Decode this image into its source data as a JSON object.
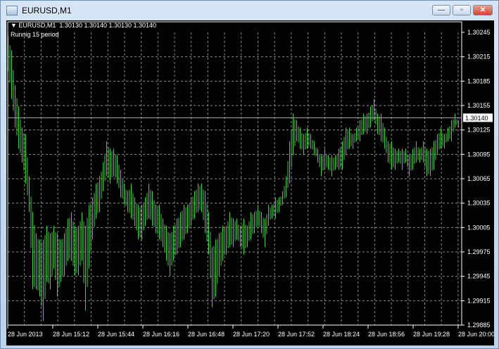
{
  "window": {
    "title": "EURUSD,M1",
    "minimize": "—",
    "maximize": "▫",
    "close": "✕"
  },
  "chart": {
    "header": "▼ EURUSD,M1  1.30130 1.30140 1.30130 1.30140",
    "indicator_label": "Runnig 15  period",
    "current_price": "1.30140",
    "colors": {
      "background": "#000000",
      "bars": "#3fcf3f",
      "grid": "#8a8a8a",
      "text": "#ffffff"
    }
  },
  "chart_data": {
    "type": "bar",
    "title": "EURUSD,M1",
    "ylim": [
      1.29885,
      1.30245
    ],
    "price_ticks": [
      "1.30245",
      "1.30215",
      "1.30185",
      "1.30155",
      "1.30125",
      "1.30095",
      "1.30065",
      "1.30035",
      "1.30005",
      "1.29975",
      "1.29945",
      "1.29915",
      "1.29885"
    ],
    "time_ticks": [
      "28 Jun 2013",
      "28 Jun 15:12",
      "28 Jun 15:44",
      "28 Jun 16:16",
      "28 Jun 16:48",
      "28 Jun 17:20",
      "28 Jun 17:52",
      "28 Jun 18:24",
      "28 Jun 18:56",
      "28 Jun 19:28",
      "28 Jun 20:00"
    ],
    "base_price": 1.29885,
    "point": 1e-05,
    "high_points": [
      356,
      338,
      295,
      269,
      243,
      235,
      183,
      139,
      113,
      105,
      105,
      122,
      113,
      122,
      113,
      105,
      113,
      131,
      139,
      122,
      122,
      139,
      122,
      148,
      157,
      174,
      183,
      200,
      226,
      217,
      217,
      209,
      191,
      174,
      165,
      174,
      157,
      148,
      148,
      157,
      174,
      165,
      148,
      148,
      131,
      122,
      113,
      122,
      131,
      139,
      148,
      148,
      157,
      165,
      174,
      174,
      165,
      139,
      96,
      105,
      113,
      122,
      122,
      139,
      131,
      131,
      122,
      131,
      122,
      139,
      139,
      148,
      139,
      131,
      148,
      148,
      157,
      157,
      165,
      183,
      226,
      260,
      252,
      243,
      235,
      243,
      235,
      226,
      217,
      209,
      217,
      209,
      209,
      209,
      217,
      226,
      243,
      243,
      235,
      243,
      252,
      260,
      260,
      269,
      278,
      260,
      260,
      243,
      226,
      226,
      217,
      217,
      217,
      217,
      209,
      217,
      226,
      217,
      226,
      217,
      217,
      226,
      235,
      243,
      235,
      243,
      252,
      260,
      252
    ],
    "low_points": [
      312,
      278,
      243,
      217,
      200,
      174,
      139,
      44,
      44,
      35,
      5,
      53,
      44,
      70,
      35,
      53,
      61,
      79,
      79,
      61,
      61,
      79,
      18,
      70,
      105,
      131,
      139,
      165,
      183,
      174,
      183,
      174,
      157,
      148,
      139,
      131,
      122,
      105,
      105,
      122,
      131,
      122,
      113,
      105,
      96,
      79,
      61,
      79,
      87,
      96,
      105,
      113,
      122,
      131,
      139,
      139,
      113,
      87,
      22,
      35,
      61,
      79,
      87,
      96,
      96,
      105,
      96,
      87,
      96,
      105,
      113,
      122,
      113,
      96,
      122,
      131,
      131,
      139,
      148,
      157,
      174,
      209,
      226,
      217,
      209,
      217,
      217,
      209,
      200,
      183,
      191,
      191,
      183,
      191,
      191,
      191,
      209,
      217,
      217,
      226,
      226,
      235,
      235,
      243,
      252,
      235,
      226,
      217,
      200,
      191,
      191,
      200,
      191,
      200,
      183,
      191,
      200,
      200,
      200,
      183,
      183,
      191,
      209,
      217,
      217,
      226,
      226,
      243,
      243
    ]
  }
}
